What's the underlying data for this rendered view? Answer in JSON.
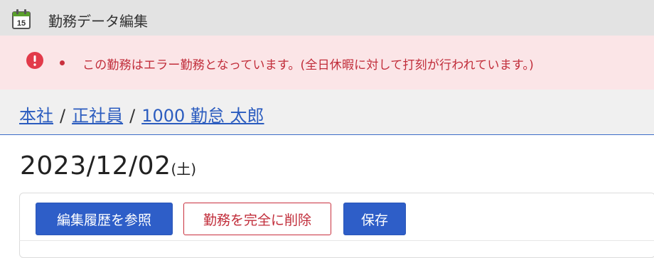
{
  "window": {
    "title": "勤務データ編集",
    "icon": "calendar-icon",
    "icon_day": "15"
  },
  "alert": {
    "icon": "exclamation-circle-icon",
    "message": "この勤務はエラー勤務となっています。(全日休暇に対して打刻が行われています。)",
    "color": "#c12d3a",
    "background": "#fbe5e7"
  },
  "breadcrumb": {
    "items": [
      "本社",
      "正社員",
      "1000 勤怠 太郎"
    ],
    "separator": "/"
  },
  "date": {
    "value": "2023/12/02",
    "weekday": "(土)"
  },
  "actions": {
    "history_label": "編集履歴を参照",
    "delete_label": "勤務を完全に削除",
    "save_label": "保存"
  },
  "colors": {
    "primary": "#2e5ec8",
    "danger": "#c12d3a",
    "link": "#2b5cbf"
  }
}
